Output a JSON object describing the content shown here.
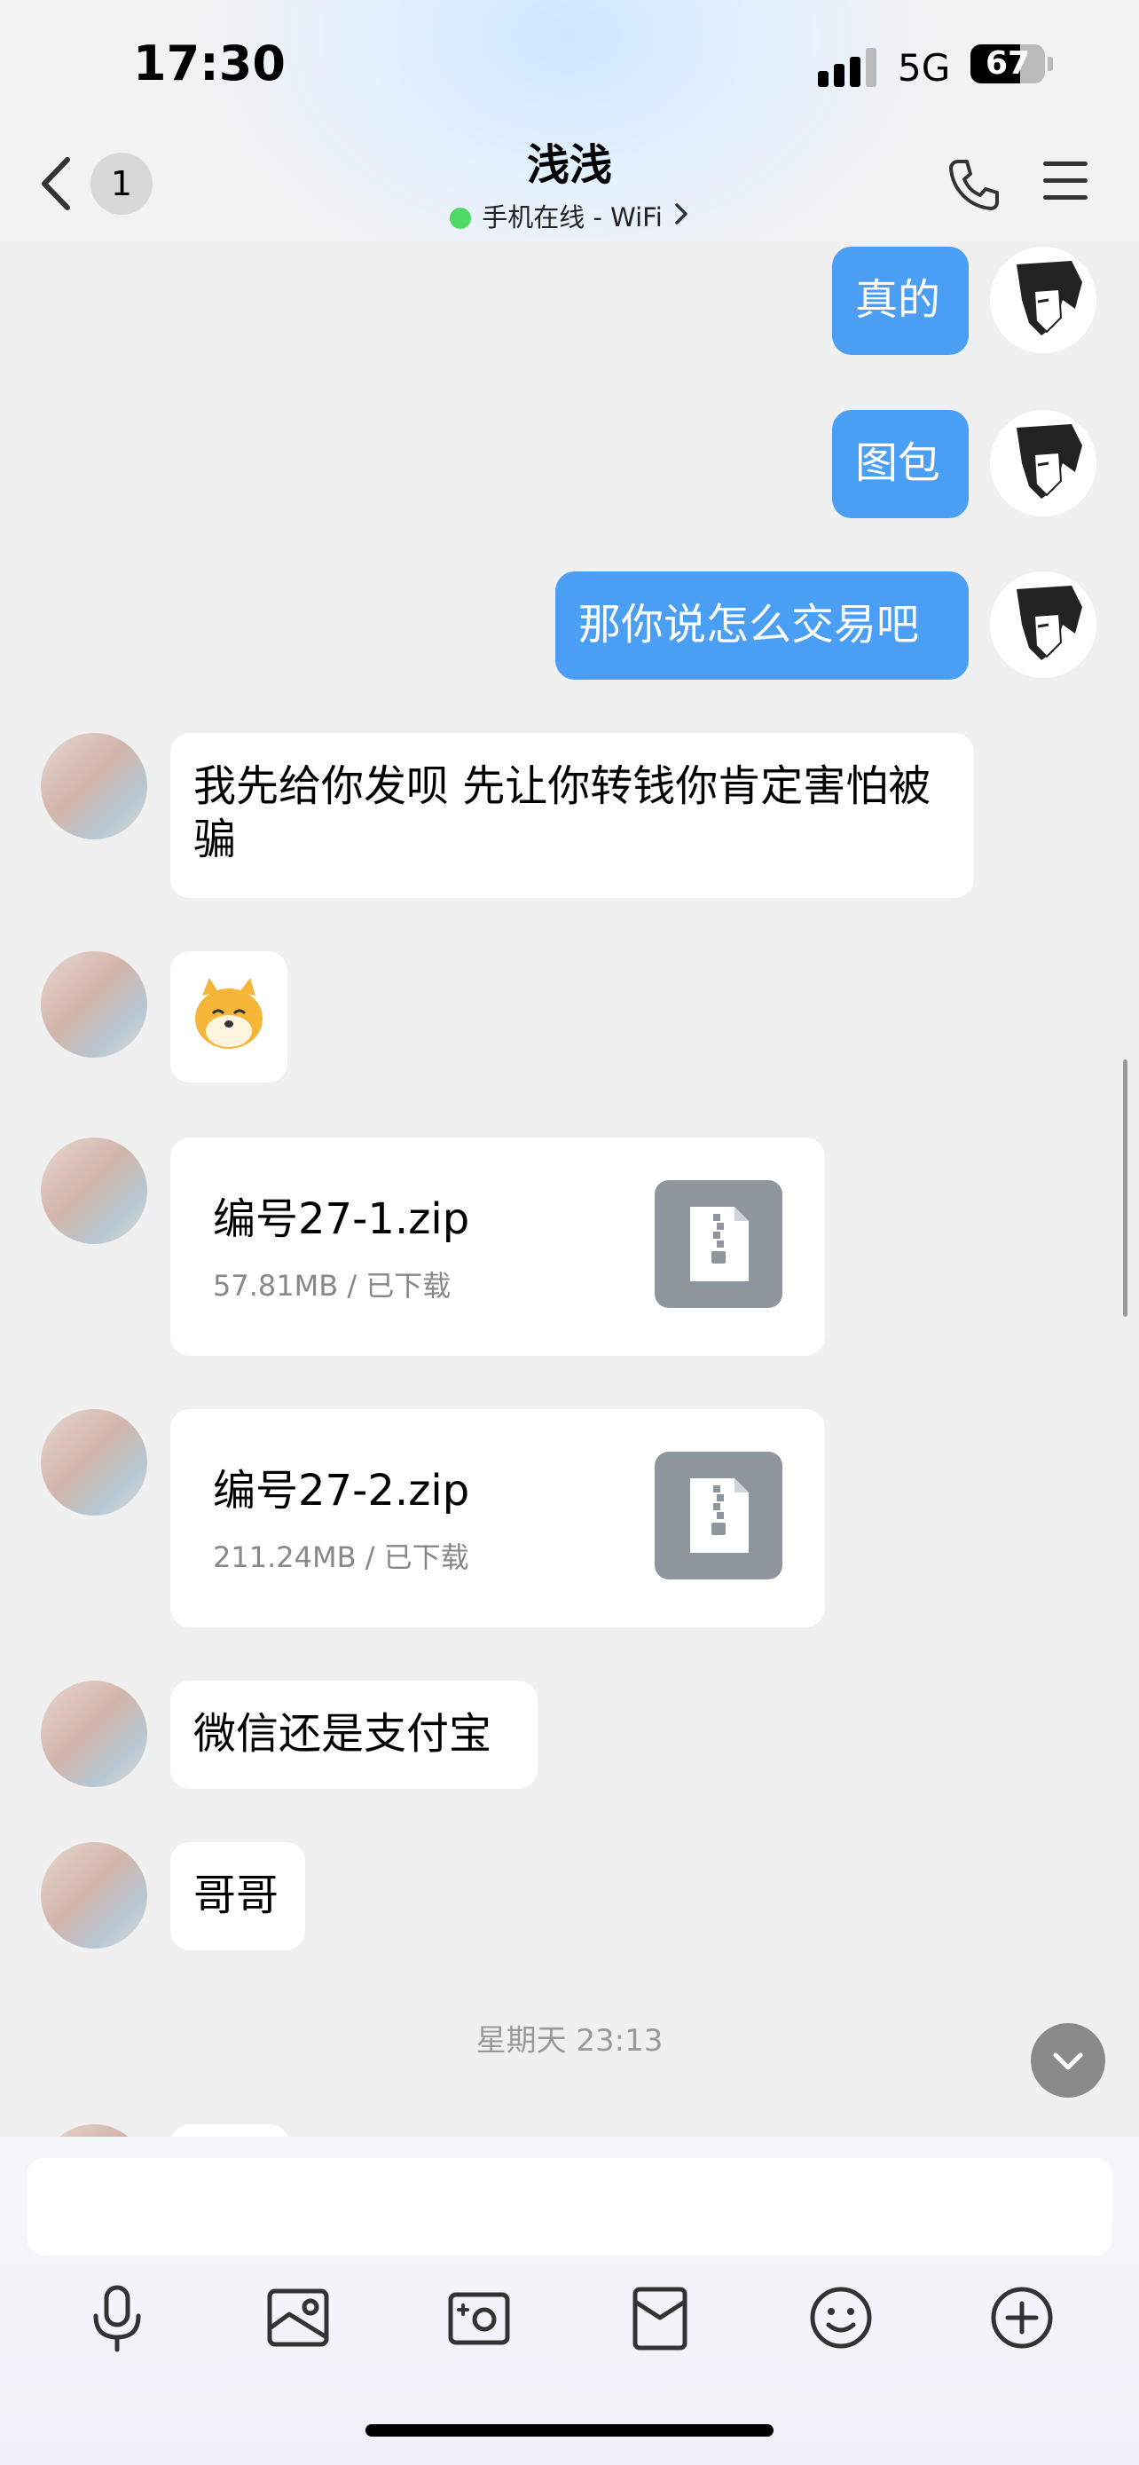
{
  "status_bar": {
    "time": "17:30",
    "network": "5G",
    "battery": "67",
    "battery_fraction": 0.67
  },
  "header": {
    "back_badge": "1",
    "contact_name": "浅浅",
    "online_status": "手机在线 - WiFi",
    "icons": [
      "chevron-left-icon",
      "phone-icon",
      "menu-icon",
      "chevron-right-icon"
    ]
  },
  "messages": [
    {
      "side": "out",
      "type": "text",
      "text": "真的"
    },
    {
      "side": "out",
      "type": "text",
      "text": "图包"
    },
    {
      "side": "out",
      "type": "text",
      "text": "那你说怎么交易吧"
    },
    {
      "side": "in",
      "type": "text",
      "text": "我先给你发呗  先让你转钱你肯定害怕被骗"
    },
    {
      "side": "in",
      "type": "sticker",
      "sticker": "shiba-dog-sticker"
    },
    {
      "side": "in",
      "type": "file",
      "name": "编号27-1.zip",
      "meta": "57.81MB / 已下载"
    },
    {
      "side": "in",
      "type": "file",
      "name": "编号27-2.zip",
      "meta": "211.24MB / 已下载"
    },
    {
      "side": "in",
      "type": "text",
      "text": "微信还是支付宝"
    },
    {
      "side": "in",
      "type": "text",
      "text": "哥哥"
    }
  ],
  "timestamp": "星期天 23:13",
  "input": {
    "placeholder": "",
    "value": ""
  },
  "toolbar": [
    "mic-icon",
    "image-icon",
    "camera-icon",
    "red-envelope-icon",
    "emoji-icon",
    "plus-circle-icon"
  ],
  "colors": {
    "outgoing_bubble": "#4a9ff5",
    "incoming_bubble": "#ffffff",
    "chat_background": "#f0f0f0",
    "online_dot": "#4cd964"
  }
}
